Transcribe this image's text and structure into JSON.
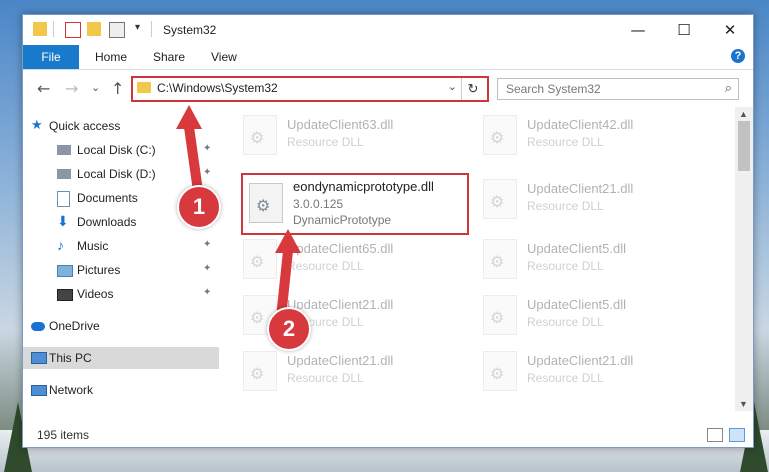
{
  "window": {
    "title": "System32"
  },
  "ribbon": {
    "tabs": [
      "File",
      "Home",
      "Share",
      "View"
    ],
    "help": "?"
  },
  "window_controls": {
    "minimize": "—",
    "maximize": "☐",
    "close": "✕"
  },
  "nav": {
    "back": "←",
    "forward": "→",
    "recent": "⌄",
    "up": "↑",
    "address": "C:\\Windows\\System32",
    "address_dropdown": "⌄",
    "refresh": "↻",
    "search_placeholder": "Search System32",
    "search_icon": "⌕"
  },
  "sidebar": {
    "items": [
      {
        "label": "Quick access",
        "icon": "star-icon",
        "pinned": false
      },
      {
        "label": "Local Disk (C:)",
        "icon": "drive-icon",
        "pinned": true
      },
      {
        "label": "Local Disk (D:)",
        "icon": "drive-icon",
        "pinned": true
      },
      {
        "label": "Documents",
        "icon": "documents-icon",
        "pinned": true
      },
      {
        "label": "Downloads",
        "icon": "downloads-icon",
        "pinned": true
      },
      {
        "label": "Music",
        "icon": "music-icon",
        "pinned": true
      },
      {
        "label": "Pictures",
        "icon": "pictures-icon",
        "pinned": true
      },
      {
        "label": "Videos",
        "icon": "videos-icon",
        "pinned": true
      },
      {
        "label": "OneDrive",
        "icon": "cloud-icon",
        "pinned": false
      },
      {
        "label": "This PC",
        "icon": "computer-icon",
        "pinned": false,
        "selected": true
      },
      {
        "label": "Network",
        "icon": "network-icon",
        "pinned": false
      }
    ],
    "pin_glyph": "📌"
  },
  "files": {
    "col1": [
      {
        "name": "UpdateClient63.dll",
        "sub": "Resource DLL"
      },
      {
        "name": "eondynamicprototype.dll",
        "sub": "3.0.0.125",
        "sub2": "DynamicPrototype"
      },
      {
        "name": "UpdateClient65.dll",
        "sub": "Resource DLL"
      },
      {
        "name": "UpdateClient21.dll",
        "sub": "Resource DLL"
      },
      {
        "name": "UpdateClient21.dll",
        "sub": "Resource DLL"
      }
    ],
    "col2": [
      {
        "name": "UpdateClient42.dll",
        "sub": "Resource DLL"
      },
      {
        "name": "UpdateClient21.dll",
        "sub": "Resource DLL"
      },
      {
        "name": "UpdateClient5.dll",
        "sub": "Resource DLL"
      },
      {
        "name": "UpdateClient5.dll",
        "sub": "Resource DLL"
      },
      {
        "name": "UpdateClient21.dll",
        "sub": "Resource DLL"
      }
    ]
  },
  "status": {
    "count": "195 items"
  },
  "annotations": {
    "badge1": "1",
    "badge2": "2"
  },
  "colors": {
    "accent": "#1979ca",
    "highlight": "#d0353b",
    "arrow": "#d8393d"
  }
}
